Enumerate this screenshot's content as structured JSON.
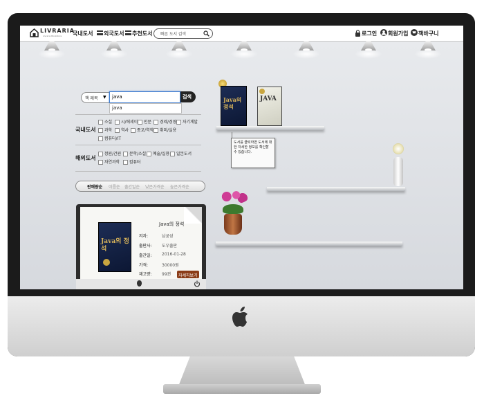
{
  "header": {
    "logo_text": "LIVRARIA",
    "logo_sub": "Livraria Bookstore",
    "nav": [
      "국내도서",
      "외국도서",
      "추천도서"
    ],
    "search_placeholder": "빠른 도서 검색",
    "login": "로그인",
    "signup": "회원가입",
    "cart": "책바구니"
  },
  "search": {
    "field_select": "책 제목",
    "query": "java",
    "button": "검색",
    "suggestion": "java"
  },
  "categories": {
    "domestic_label": "국내도서",
    "domestic": [
      "소설",
      "시/에세이",
      "인문",
      "경제/경영",
      "자기계발",
      "과학",
      "역사",
      "종교/역학",
      "취미/실용",
      "컴퓨터/IT"
    ],
    "foreign_label": "해외도서",
    "foreign": [
      "정원/건원",
      "문학/소설",
      "예술/실용",
      "일본도서",
      "자연과학",
      "컴퓨터"
    ]
  },
  "sort": {
    "options": [
      "판매량순",
      "이름순",
      "출간일순",
      "낮은가격순",
      "높은가격순"
    ],
    "active": 0
  },
  "book_card": {
    "title": "Java의 정석",
    "author_label": "저자:",
    "author": "남궁성",
    "publisher_label": "출판사:",
    "publisher": "도우출판",
    "date_label": "출간일:",
    "date": "2016-01-28",
    "price_label": "가격:",
    "price": "30000원",
    "stock_label": "재고량:",
    "stock": "99권",
    "detail_button": "자세히보기"
  },
  "shelf": {
    "book1_title": "Java의 정석",
    "book2_title": "JAVA",
    "note": "도서를 클릭하면 도서에 대한 자세한 정보를 확인할 수 있습니다."
  },
  "colors": {
    "screen_bg": "#e0e3e7",
    "bezel": "#1b1b1b",
    "detail_button": "#8a3b16"
  }
}
